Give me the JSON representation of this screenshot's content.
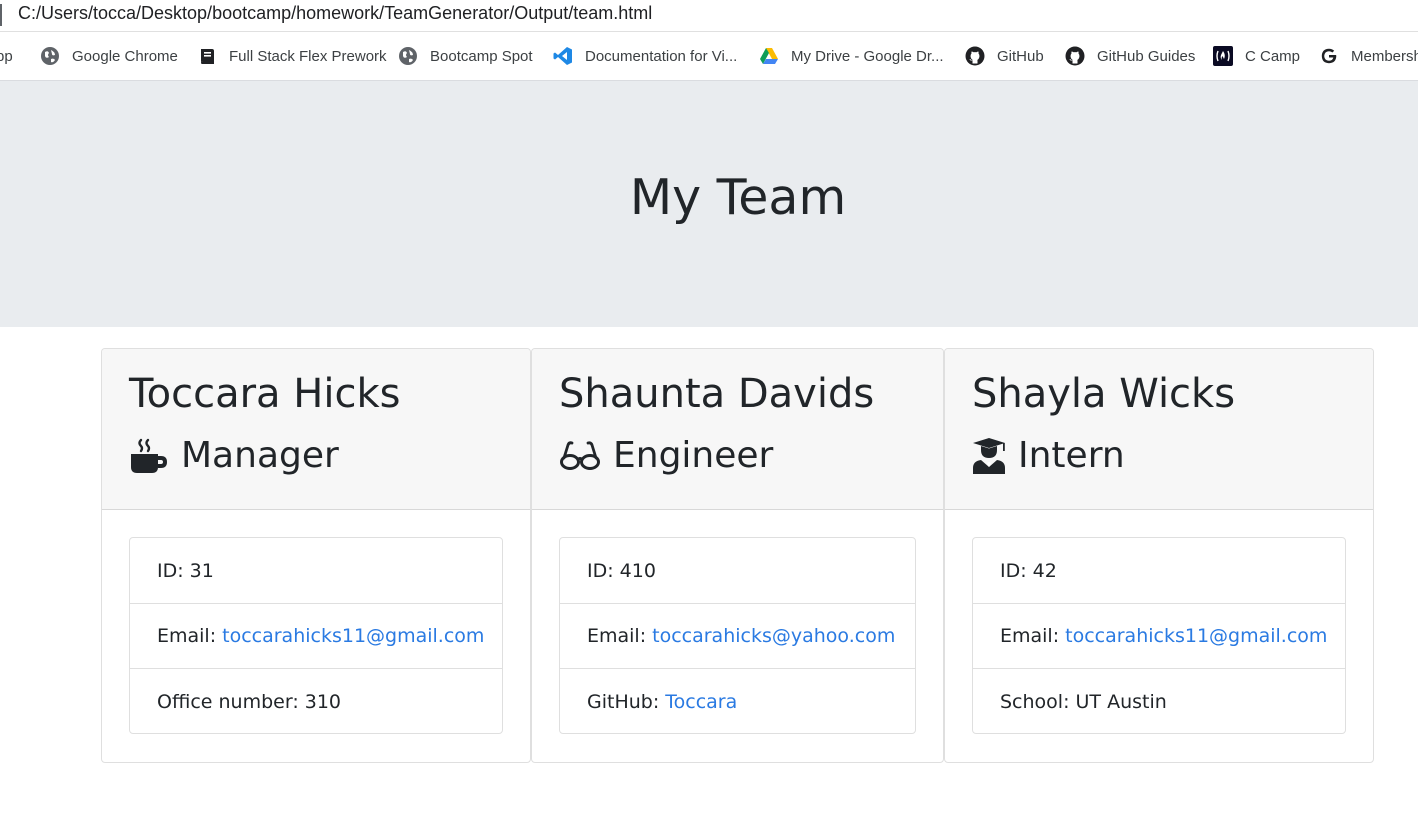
{
  "browser": {
    "address": "C:/Users/tocca/Desktop/bootcamp/homework/TeamGenerator/Output/team.html",
    "bookmarks": [
      {
        "label": "pp",
        "icon": "none"
      },
      {
        "label": "Google Chrome",
        "icon": "globe-icon"
      },
      {
        "label": "Full Stack Flex Prework",
        "icon": "book-icon"
      },
      {
        "label": "Bootcamp Spot",
        "icon": "globe-icon"
      },
      {
        "label": "Documentation for Vi...",
        "icon": "vscode-icon"
      },
      {
        "label": "My Drive - Google Dr...",
        "icon": "google-drive-icon"
      },
      {
        "label": "GitHub",
        "icon": "github-icon"
      },
      {
        "label": "GitHub Guides",
        "icon": "github-icon"
      },
      {
        "label": "C Camp",
        "icon": "freecodecamp-icon"
      },
      {
        "label": "Membersh",
        "icon": "google-icon"
      }
    ]
  },
  "page": {
    "title": "My Team"
  },
  "colors": {
    "jumbotron": "#e9ecef",
    "card_header": "#f7f7f7",
    "link": "#2a7ae2",
    "text": "#212529"
  },
  "cards": [
    {
      "name": "Toccara Hicks",
      "role": "Manager",
      "role_icon": "mug-hot-icon",
      "id_text": "ID: 31",
      "email_label": "Email:",
      "email": "toccarahicks11@gmail.com",
      "extra_label": "Office number: 310",
      "extra_link": ""
    },
    {
      "name": "Shaunta Davids",
      "role": "Engineer",
      "role_icon": "glasses-icon",
      "id_text": "ID: 410",
      "email_label": "Email:",
      "email": "toccarahicks@yahoo.com",
      "extra_label": "GitHub:",
      "extra_link": "Toccara"
    },
    {
      "name": "Shayla Wicks",
      "role": "Intern",
      "role_icon": "user-graduate-icon",
      "id_text": "ID: 42",
      "email_label": "Email:",
      "email": "toccarahicks11@gmail.com",
      "extra_label": "School: UT Austin",
      "extra_link": ""
    }
  ]
}
